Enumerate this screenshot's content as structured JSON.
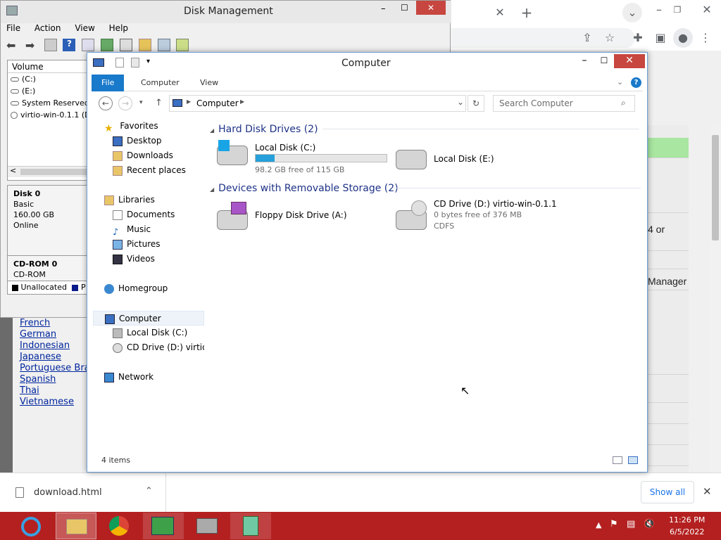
{
  "chrome": {
    "partial_text_1": "4 or",
    "partial_text_2": "Manager"
  },
  "languages": [
    "French",
    "German",
    "Indonesian",
    "Japanese",
    "Portuguese Bra",
    "Spanish",
    "Thai",
    "Vietnamese"
  ],
  "download_bar": {
    "filename": "download.html",
    "show_all": "Show all"
  },
  "disk_management": {
    "title": "Disk Management",
    "menu": [
      "File",
      "Action",
      "View",
      "Help"
    ],
    "volume_header": "Volume",
    "volumes": [
      "(C:)",
      "(E:)",
      "System Reserved",
      "virtio-win-0.1.1 (D"
    ],
    "disk0": {
      "name": "Disk 0",
      "type": "Basic",
      "size": "160.00 GB",
      "status": "Online"
    },
    "cdrom": {
      "name": "CD-ROM 0",
      "type": "CD-ROM"
    },
    "legend": [
      "Unallocated",
      "P"
    ]
  },
  "explorer": {
    "title": "Computer",
    "ribbon_tabs": [
      "File",
      "Computer",
      "View"
    ],
    "address": "Computer",
    "search_placeholder": "Search Computer",
    "nav": {
      "favorites": "Favorites",
      "desktop": "Desktop",
      "downloads": "Downloads",
      "recent": "Recent places",
      "libraries": "Libraries",
      "documents": "Documents",
      "music": "Music",
      "pictures": "Pictures",
      "videos": "Videos",
      "homegroup": "Homegroup",
      "computer": "Computer",
      "local_c": "Local Disk (C:)",
      "cd_drive": "CD Drive (D:) virtio-w",
      "network": "Network"
    },
    "hdd_group": "Hard Disk Drives (2)",
    "removable_group": "Devices with Removable Storage (2)",
    "drives": {
      "c": {
        "name": "Local Disk (C:)",
        "free": "98.2 GB free of 115 GB",
        "used_fraction": 0.146
      },
      "e": {
        "name": "Local Disk (E:)"
      },
      "a": {
        "name": "Floppy Disk Drive (A:)"
      },
      "d": {
        "name": "CD Drive (D:) virtio-win-0.1.1",
        "free": "0 bytes free of 376 MB",
        "fs": "CDFS"
      }
    },
    "status": "4 items"
  },
  "taskbar": {
    "time": "11:26 PM",
    "date": "6/5/2022"
  }
}
